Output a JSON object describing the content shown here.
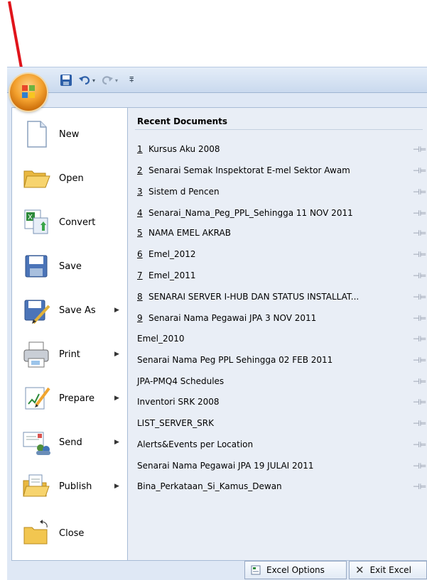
{
  "quick_access": {
    "save_icon": "save-icon",
    "undo_icon": "undo-icon",
    "redo_icon": "redo-icon",
    "customize_icon": "customize-icon"
  },
  "office_button": {
    "icon": "office-logo-icon"
  },
  "commands": [
    {
      "label": "New",
      "icon": "new-document-icon",
      "submenu": false
    },
    {
      "label": "Open",
      "icon": "open-folder-icon",
      "submenu": false
    },
    {
      "label": "Convert",
      "icon": "convert-icon",
      "submenu": false
    },
    {
      "label": "Save",
      "icon": "save-disk-icon",
      "submenu": false
    },
    {
      "label": "Save As",
      "icon": "save-as-icon",
      "submenu": true
    },
    {
      "label": "Print",
      "icon": "printer-icon",
      "submenu": true
    },
    {
      "label": "Prepare",
      "icon": "prepare-icon",
      "submenu": true
    },
    {
      "label": "Send",
      "icon": "send-icon",
      "submenu": true
    },
    {
      "label": "Publish",
      "icon": "publish-icon",
      "submenu": true
    },
    {
      "label": "Close",
      "icon": "close-folder-icon",
      "submenu": false
    }
  ],
  "recent": {
    "title": "Recent Documents",
    "items": [
      {
        "num": "1",
        "name": "Kursus Aku 2008"
      },
      {
        "num": "2",
        "name": "Senarai Semak Inspektorat E-mel Sektor Awam"
      },
      {
        "num": "3",
        "name": "Sistem d Pencen"
      },
      {
        "num": "4",
        "name": "Senarai_Nama_Peg_PPL_Sehingga 11 NOV 2011"
      },
      {
        "num": "5",
        "name": "NAMA EMEL AKRAB"
      },
      {
        "num": "6",
        "name": "Emel_2012"
      },
      {
        "num": "7",
        "name": "Emel_2011"
      },
      {
        "num": "8",
        "name": "SENARAI SERVER I-HUB DAN STATUS INSTALLAT..."
      },
      {
        "num": "9",
        "name": "Senarai Nama Pegawai JPA 3 NOV 2011"
      },
      {
        "num": "",
        "name": "Emel_2010"
      },
      {
        "num": "",
        "name": "Senarai Nama Peg PPL Sehingga 02 FEB 2011"
      },
      {
        "num": "",
        "name": "JPA-PMQ4 Schedules"
      },
      {
        "num": "",
        "name": "Inventori SRK 2008"
      },
      {
        "num": "",
        "name": "LIST_SERVER_SRK"
      },
      {
        "num": "",
        "name": "Alerts&Events per Location"
      },
      {
        "num": "",
        "name": "Senarai Nama Pegawai JPA 19 JULAI 2011"
      },
      {
        "num": "",
        "name": "Bina_Perkataan_Si_Kamus_Dewan"
      }
    ],
    "pin_glyph": "⊣⊨"
  },
  "footer": {
    "options_label": "Excel Options",
    "exit_label": "Exit Excel"
  },
  "colors": {
    "arrow": "#e0141b",
    "office_orange": "#f3a12e"
  }
}
